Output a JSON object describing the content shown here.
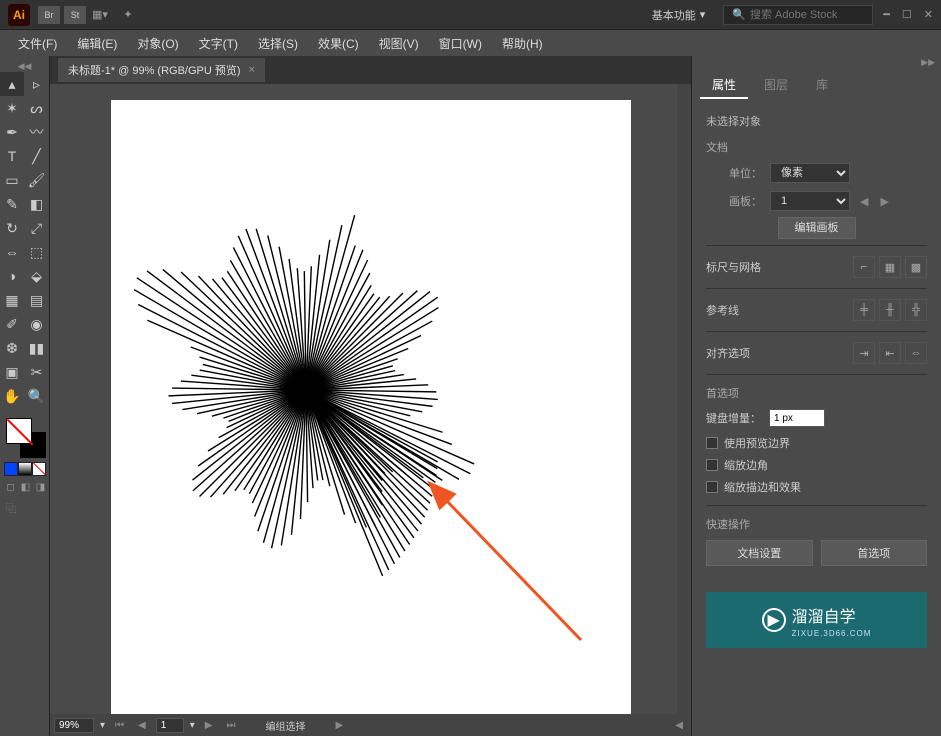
{
  "app": {
    "logo": "Ai"
  },
  "top": {
    "tiles": [
      "Br",
      "St"
    ],
    "workspace": "基本功能",
    "search_placeholder": "搜索 Adobe Stock"
  },
  "menu": {
    "file": "文件(F)",
    "edit": "编辑(E)",
    "object": "对象(O)",
    "type": "文字(T)",
    "select": "选择(S)",
    "effect": "效果(C)",
    "view": "视图(V)",
    "window": "窗口(W)",
    "help": "帮助(H)"
  },
  "doc": {
    "tab_title": "未标题-1* @ 99% (RGB/GPU 预览)"
  },
  "status": {
    "zoom": "99%",
    "page": "1",
    "mode": "编组选择"
  },
  "panel": {
    "tabs": {
      "attrs": "属性",
      "layers": "图层",
      "libs": "库"
    },
    "no_selection": "未选择对象",
    "document": "文档",
    "units_label": "单位：",
    "units_value": "像素",
    "artboard_label": "画板：",
    "artboard_value": "1",
    "edit_artboard": "编辑画板",
    "ruler_grid": "标尺与网格",
    "guides": "参考线",
    "align_options": "对齐选项",
    "preferences": "首选项",
    "kb_increment_label": "键盘增量：",
    "kb_increment_value": "1 px",
    "use_preview_bounds": "使用预览边界",
    "scale_corners": "缩放边角",
    "scale_strokes": "缩放描边和效果",
    "quick_actions": "快速操作",
    "doc_setup": "文档设置",
    "prefs_btn": "首选项"
  },
  "watermark": {
    "text": "溜溜自学",
    "sub": "ZIXUE.3D66.COM"
  }
}
